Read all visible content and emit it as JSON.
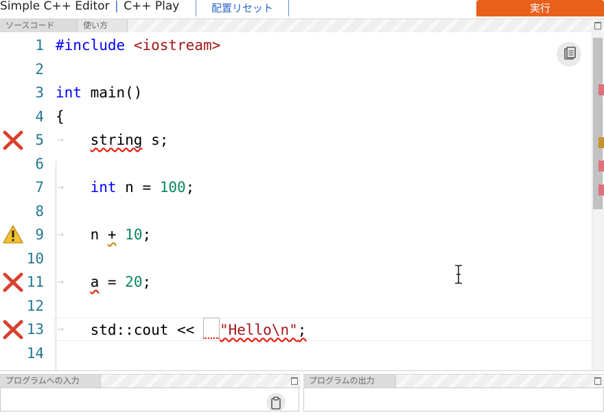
{
  "header": {
    "app_title": "Simple C++ Editor",
    "separator": "|",
    "app_sub": "C++ Play",
    "reset_layout": "配置リセット",
    "run": "実行"
  },
  "editor_pane": {
    "tabs": [
      "ソースコード",
      "使い方"
    ]
  },
  "editor": {
    "lines": [
      {
        "n": "1",
        "tokens": [
          {
            "t": "#include",
            "c": "pre"
          },
          {
            "t": " "
          },
          {
            "t": "<iostream>",
            "c": "inc"
          }
        ]
      },
      {
        "n": "2",
        "tokens": []
      },
      {
        "n": "3",
        "tokens": [
          {
            "t": "int",
            "c": "kw"
          },
          {
            "t": " main()"
          }
        ]
      },
      {
        "n": "4",
        "tokens": [
          {
            "t": "{"
          }
        ]
      },
      {
        "n": "5",
        "marker": "error",
        "tokens": [
          {
            "t": "    "
          },
          {
            "t": "string",
            "sq": "red"
          },
          {
            "t": " s;"
          }
        ]
      },
      {
        "n": "6",
        "tokens": []
      },
      {
        "n": "7",
        "tokens": [
          {
            "t": "    "
          },
          {
            "t": "int",
            "c": "kw"
          },
          {
            "t": " n = "
          },
          {
            "t": "100",
            "c": "num"
          },
          {
            "t": ";"
          }
        ]
      },
      {
        "n": "8",
        "tokens": []
      },
      {
        "n": "9",
        "marker": "warning",
        "tokens": [
          {
            "t": "    n "
          },
          {
            "t": "+",
            "sq": "warn"
          },
          {
            "t": " "
          },
          {
            "t": "10",
            "c": "num"
          },
          {
            "t": ";"
          }
        ]
      },
      {
        "n": "10",
        "tokens": []
      },
      {
        "n": "11",
        "marker": "error",
        "tokens": [
          {
            "t": "    "
          },
          {
            "t": "a",
            "sq": "red"
          },
          {
            "t": " = "
          },
          {
            "t": "20",
            "c": "num"
          },
          {
            "t": ";"
          }
        ]
      },
      {
        "n": "12",
        "tokens": []
      },
      {
        "n": "13",
        "marker": "error",
        "tokens": [
          {
            "t": "    std::cout << "
          },
          {
            "t": "",
            "box": true
          },
          {
            "t": "\"Hello\\n\"",
            "c": "str",
            "sq": "red"
          },
          {
            "t": ";",
            "sq": "red"
          }
        ]
      },
      {
        "n": "14",
        "tokens": []
      }
    ],
    "overview_marks": [
      {
        "kind": "error",
        "color": "#e0707c",
        "level": 0.155
      },
      {
        "kind": "warning",
        "color": "#c8922b",
        "level": 0.31
      },
      {
        "kind": "error",
        "color": "#e0707c",
        "level": 0.38
      },
      {
        "kind": "error",
        "color": "#e0707c",
        "level": 0.45
      }
    ]
  },
  "input_pane": {
    "tab": "プログラムへの入力"
  },
  "output_pane": {
    "tab": "プログラムの出力"
  },
  "colors": {
    "run_button": "#e8601c",
    "link_blue": "#2b67c8",
    "error_red": "#e51400",
    "warning_amber": "#bf8803"
  },
  "icons": {
    "copy": "clipboard-icon",
    "error": "error-x-icon",
    "warning": "warning-triangle-icon",
    "maximize": "maximize-icon",
    "cursor": "ibeam-cursor-icon"
  }
}
